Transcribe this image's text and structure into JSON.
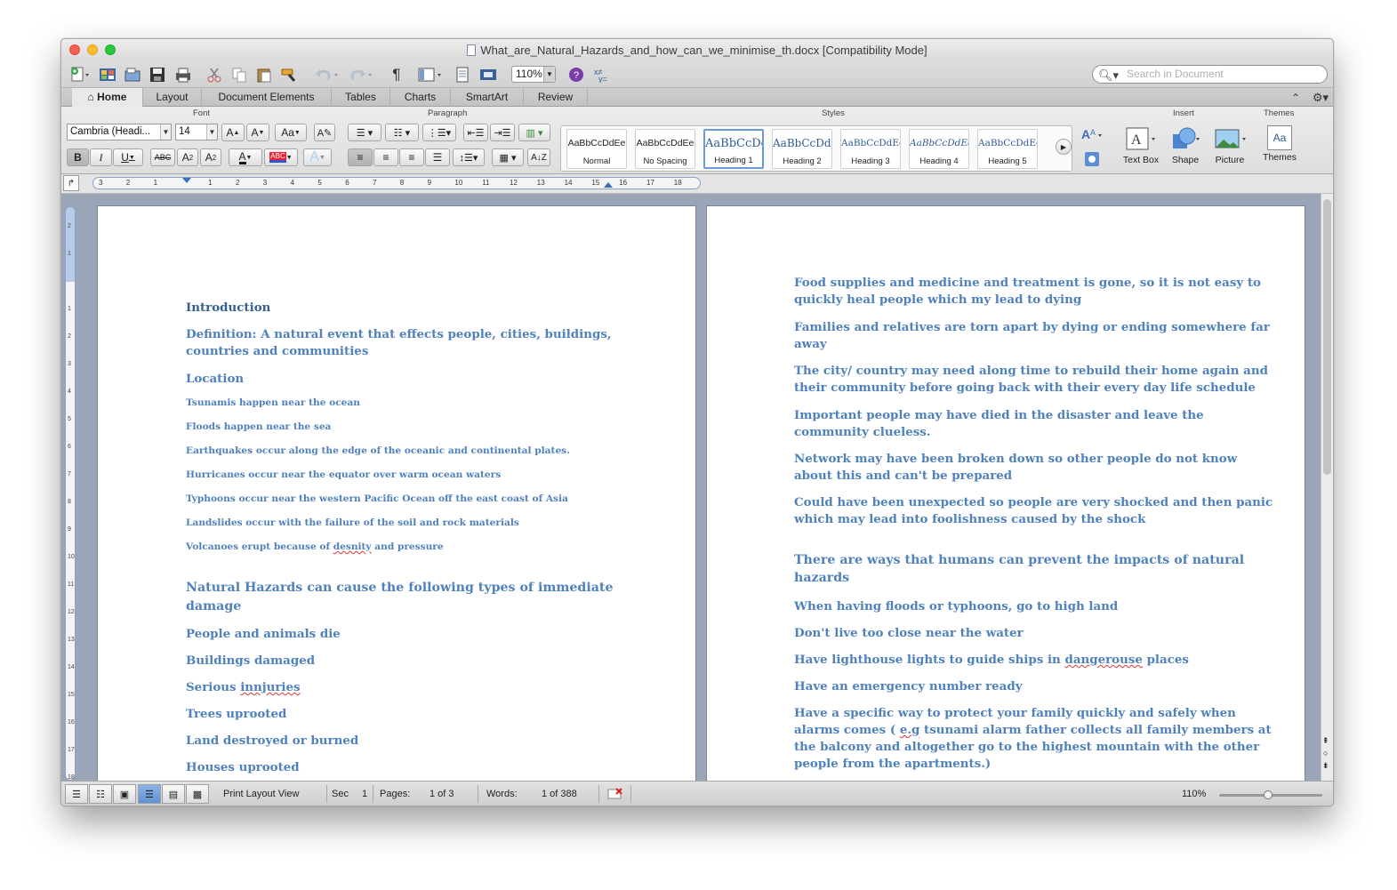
{
  "window": {
    "title": "What_are_Natural_Hazards_and_how_can_we_minimise_th.docx [Compatibility Mode]"
  },
  "standard_toolbar": {
    "zoom_value": "110%",
    "search_placeholder": "Search in Document",
    "pilcrow": "¶"
  },
  "tabs": [
    {
      "label": "Home",
      "active": true
    },
    {
      "label": "Layout"
    },
    {
      "label": "Document Elements"
    },
    {
      "label": "Tables"
    },
    {
      "label": "Charts"
    },
    {
      "label": "SmartArt"
    },
    {
      "label": "Review"
    }
  ],
  "ribbon": {
    "groups": {
      "font": "Font",
      "paragraph": "Paragraph",
      "styles": "Styles",
      "insert": "Insert",
      "themes": "Themes"
    },
    "font_name": "Cambria (Headi...",
    "font_size": "14",
    "grow_font": "A",
    "shrink_font": "A",
    "change_case": "Aa",
    "bold": "B",
    "italic": "I",
    "underline": "U",
    "strike": "ABC",
    "superscript": "A",
    "subscript": "A",
    "font_color": "A",
    "highlight": "ABC",
    "text_effects": "A",
    "styles": [
      {
        "sample": "AaBbCcDdEe",
        "name": "Normal"
      },
      {
        "sample": "AaBbCcDdEe",
        "name": "No Spacing"
      },
      {
        "sample": "AaBbCcDd",
        "name": "Heading 1",
        "selected": true
      },
      {
        "sample": "AaBbCcDdI",
        "name": "Heading 2"
      },
      {
        "sample": "AaBbCcDdEe",
        "name": "Heading 3"
      },
      {
        "sample": "AaBbCcDdEe",
        "name": "Heading 4"
      },
      {
        "sample": "AaBbCcDdEe",
        "name": "Heading 5"
      }
    ],
    "insert": {
      "text_box": "Text Box",
      "shape": "Shape",
      "picture": "Picture"
    },
    "themes_label": "Themes",
    "themes_icon": "Aa"
  },
  "ruler": {
    "marks": [
      "3",
      "2",
      "1",
      "",
      "1",
      "2",
      "3",
      "4",
      "5",
      "6",
      "7",
      "8",
      "9",
      "10",
      "11",
      "12",
      "13",
      "14",
      "15",
      "16",
      "17",
      "18"
    ],
    "vmarks": [
      "2",
      "1",
      "",
      "1",
      "2",
      "3",
      "4",
      "5",
      "6",
      "7",
      "8",
      "9",
      "10",
      "11",
      "12",
      "13",
      "14",
      "15",
      "16",
      "17",
      "18"
    ]
  },
  "page1": {
    "paragraphs": [
      {
        "text": "Introduction",
        "style": "ttl"
      },
      {
        "text": "Definition: A natural event that effects people, cities, buildings,",
        "style": "p13"
      },
      {
        "text": "countries and communities",
        "style": "p13"
      },
      {
        "text": "Location",
        "style": "p13"
      },
      {
        "text": "Tsunamis happen near the ocean",
        "style": "p11"
      },
      {
        "text": "Floods happen near the sea",
        "style": "p11"
      },
      {
        "text": "Earthquakes occur  along the edge of the oceanic and continental plates.",
        "style": "p11"
      },
      {
        "text": "Hurricanes occur near the equator over warm ocean waters",
        "style": "p11"
      },
      {
        "text": "Typhoons occur near the western Pacific Ocean off the east coast of Asia",
        "style": "p11"
      },
      {
        "text": "Landslides occur with the failure of the soil and rock materials",
        "style": "p11"
      },
      {
        "text": "Volcanoes erupt because of desnity and pressure",
        "style": "p11"
      },
      {
        "text": "Natural Hazards can cause the following types of immediate",
        "style": "p14"
      },
      {
        "text": "damage",
        "style": "p14"
      },
      {
        "text": "People and animals die",
        "style": "p13"
      },
      {
        "text": "Buildings damaged",
        "style": "p13"
      },
      {
        "text": "Serious innjuries",
        "style": "p13"
      },
      {
        "text": "Trees uprooted",
        "style": "p13"
      },
      {
        "text": "Land destroyed or burned",
        "style": "p13"
      },
      {
        "text": "Houses uprooted",
        "style": "p13"
      }
    ]
  },
  "page2": {
    "paragraphs": [
      {
        "text": "Food supplies and medicine and treatment is gone, so it is not easy to",
        "style": "p13"
      },
      {
        "text": "quickly heal people which my lead to dying",
        "style": "p13"
      },
      {
        "text": "Families and relatives are torn apart by dying or ending somewhere far",
        "style": "p13"
      },
      {
        "text": "away",
        "style": "p13"
      },
      {
        "text": "The city/ country may need along time to rebuild their home again and",
        "style": "p13"
      },
      {
        "text": "their community before going back with their every day life schedule",
        "style": "p13"
      },
      {
        "text": "Important people may have died in the disaster and leave the",
        "style": "p13"
      },
      {
        "text": "community clueless.",
        "style": "p13"
      },
      {
        "text": "Network may have been broken down so other people do not know",
        "style": "p13"
      },
      {
        "text": "about this and can't be prepared",
        "style": "p13"
      },
      {
        "text": "Could have been unexpected so people are very shocked and then panic",
        "style": "p13"
      },
      {
        "text": "which may lead into foolishness caused by the shock",
        "style": "p13"
      },
      {
        "text": "There are ways that humans can prevent the impacts of natural",
        "style": "p14"
      },
      {
        "text": "hazards",
        "style": "p14"
      },
      {
        "text": "When having floods or typhoons, go to high land",
        "style": "p13"
      },
      {
        "text": "Don't live too close near the water",
        "style": "p13"
      },
      {
        "text": "Have lighthouse lights to guide ships in dangerouse places",
        "style": "p13"
      },
      {
        "text": "Have an emergency number ready",
        "style": "p13"
      },
      {
        "text": "Have a specific way to protect your family quickly and safely when",
        "style": "p13"
      },
      {
        "text": "alarms comes ( e.g tsunami alarm father collects all family members at",
        "style": "p13"
      },
      {
        "text": "the balcony and altogether go to the highest mountain with the other",
        "style": "p13"
      },
      {
        "text": "people from the apartments.)",
        "style": "p13"
      }
    ]
  },
  "status": {
    "view": "Print Layout View",
    "sec_label": "Sec",
    "sec_value": "1",
    "pages_label": "Pages:",
    "pages_value": "1 of 3",
    "words_label": "Words:",
    "words_value": "1 of 388",
    "zoom": "110%"
  },
  "colors": {
    "heading": "#4f81bd",
    "title": "#365f91",
    "accent": "#5f92d2"
  }
}
